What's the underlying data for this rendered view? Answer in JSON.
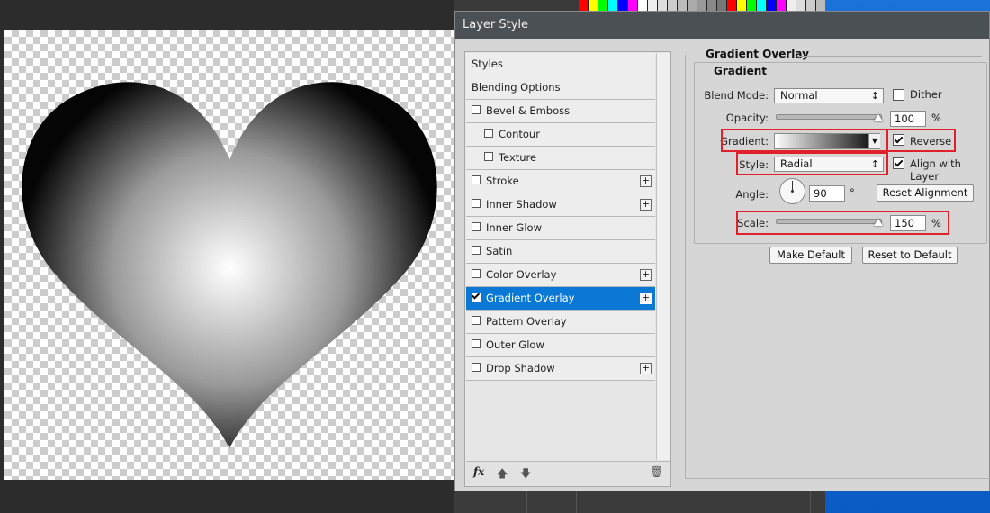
{
  "dialog": {
    "title": "Layer Style"
  },
  "styles": {
    "items": [
      {
        "label": "Styles"
      },
      {
        "label": "Blending Options"
      },
      {
        "label": "Bevel & Emboss"
      },
      {
        "label": "Contour"
      },
      {
        "label": "Texture"
      },
      {
        "label": "Stroke"
      },
      {
        "label": "Inner Shadow"
      },
      {
        "label": "Inner Glow"
      },
      {
        "label": "Satin"
      },
      {
        "label": "Color Overlay"
      },
      {
        "label": "Gradient Overlay",
        "checked": true,
        "selected": true
      },
      {
        "label": "Pattern Overlay"
      },
      {
        "label": "Outer Glow"
      },
      {
        "label": "Drop Shadow"
      }
    ],
    "footer": {
      "fx_label": "fx"
    }
  },
  "options": {
    "section_title": "Gradient Overlay",
    "group_title": "Gradient",
    "blend_mode": {
      "label": "Blend Mode:",
      "value": "Normal"
    },
    "dither": {
      "label": "Dither",
      "checked": false
    },
    "opacity": {
      "label": "Opacity:",
      "value": "100",
      "unit": "%",
      "level_percent": 100
    },
    "gradient": {
      "label": "Gradient:",
      "from_color": "#ffffff",
      "to_color": "#000000"
    },
    "reverse": {
      "label": "Reverse",
      "checked": true
    },
    "style": {
      "label": "Style:",
      "value": "Radial"
    },
    "align_with_layer": {
      "label": "Align with Layer",
      "checked": true
    },
    "angle": {
      "label": "Angle:",
      "value": "90",
      "unit": "°"
    },
    "reset_alignment_label": "Reset Alignment",
    "scale": {
      "label": "Scale:",
      "value": "150",
      "unit": "%",
      "level_percent": 100
    },
    "make_default_label": "Make Default",
    "reset_to_default_label": "Reset to Default"
  },
  "colors": {
    "highlight": "#e0202a",
    "selection": "#0a78d4"
  }
}
